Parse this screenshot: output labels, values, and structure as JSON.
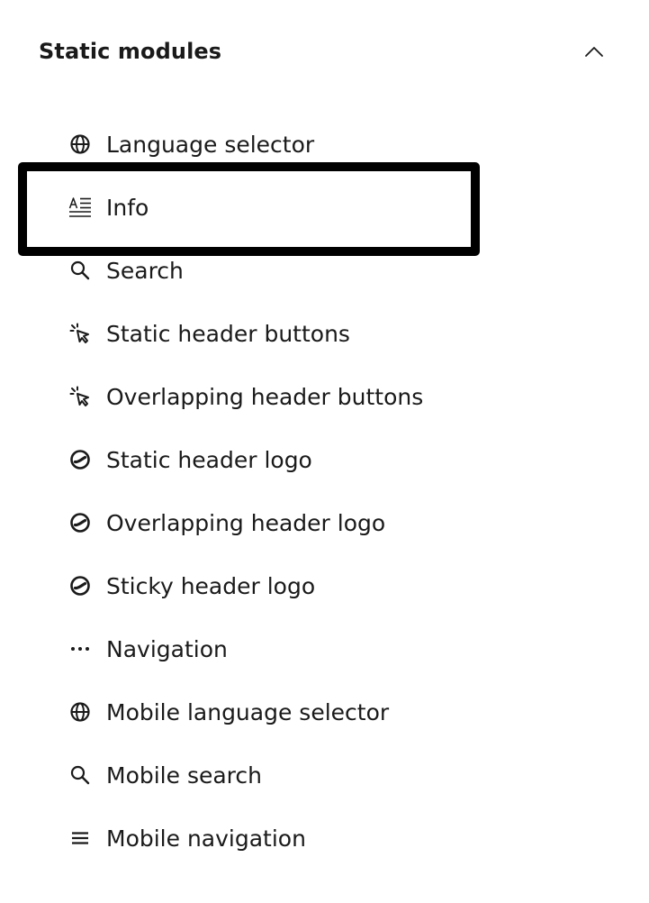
{
  "section": {
    "title": "Static modules",
    "toggle_icon": "chevron-up-icon",
    "expanded": true
  },
  "modules": [
    {
      "label": "Language selector",
      "icon": "globe-icon"
    },
    {
      "label": "Info",
      "icon": "text-block-icon",
      "highlighted": true
    },
    {
      "label": "Search",
      "icon": "search-icon"
    },
    {
      "label": "Static header buttons",
      "icon": "pointer-click-icon"
    },
    {
      "label": "Overlapping header buttons",
      "icon": "pointer-click-icon"
    },
    {
      "label": "Static header logo",
      "icon": "logo-icon"
    },
    {
      "label": "Overlapping header logo",
      "icon": "logo-icon"
    },
    {
      "label": "Sticky header logo",
      "icon": "logo-icon"
    },
    {
      "label": "Navigation",
      "icon": "more-dots-icon"
    },
    {
      "label": "Mobile language selector",
      "icon": "globe-icon"
    },
    {
      "label": "Mobile search",
      "icon": "search-icon"
    },
    {
      "label": "Mobile navigation",
      "icon": "menu-lines-icon"
    }
  ],
  "colors": {
    "text": "#1a1a1a",
    "highlight_border": "#000000",
    "background": "#ffffff"
  }
}
